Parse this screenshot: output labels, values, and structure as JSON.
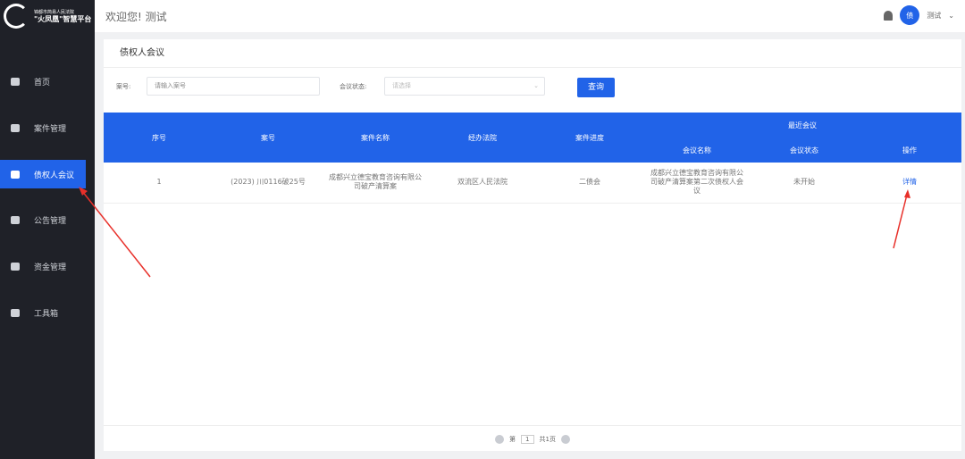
{
  "sidebar": {
    "logo_line1": "锦都市简易人民法院",
    "logo_title": "\"火凤凰\"智慧平台",
    "items": [
      {
        "label": "首页",
        "icon": "home-icon"
      },
      {
        "label": "案件管理",
        "icon": "case-icon"
      },
      {
        "label": "债权人会议",
        "icon": "video-icon",
        "active": true
      },
      {
        "label": "公告管理",
        "icon": "briefcase-icon"
      },
      {
        "label": "资金管理",
        "icon": "money-icon"
      },
      {
        "label": "工具箱",
        "icon": "toolbox-icon"
      }
    ]
  },
  "header": {
    "welcome": "欢迎您! 测试",
    "avatar_text": "债",
    "user_name": "测试"
  },
  "page": {
    "title": "债权人会议"
  },
  "filter": {
    "case_no_label": "案号:",
    "case_no_placeholder": "请输入案号",
    "status_label": "会议状态:",
    "status_placeholder": "请选择",
    "query_label": "查询"
  },
  "table": {
    "headers": {
      "index": "序号",
      "case_no": "案号",
      "case_name": "案件名称",
      "court": "经办法院",
      "progress": "案件进度",
      "recent": "最近会议",
      "meeting_name": "会议名称",
      "meeting_status": "会议状态",
      "action": "操作"
    },
    "rows": [
      {
        "index": "1",
        "case_no": "(2023) 川0116破25号",
        "case_name": "成都兴立德宝教育咨询有限公司破产清算案",
        "court": "双流区人民法院",
        "progress": "二债会",
        "meeting_name": "成都兴立德宝教育咨询有限公司破产清算案第二次债权人会议",
        "meeting_status": "未开始",
        "action": "详情"
      }
    ]
  },
  "pagination": {
    "prefix": "第",
    "page": "1",
    "total": "共1页"
  },
  "colors": {
    "accent": "#2163e8",
    "sidebar": "#1f2128",
    "annotation": "#e8302a"
  }
}
